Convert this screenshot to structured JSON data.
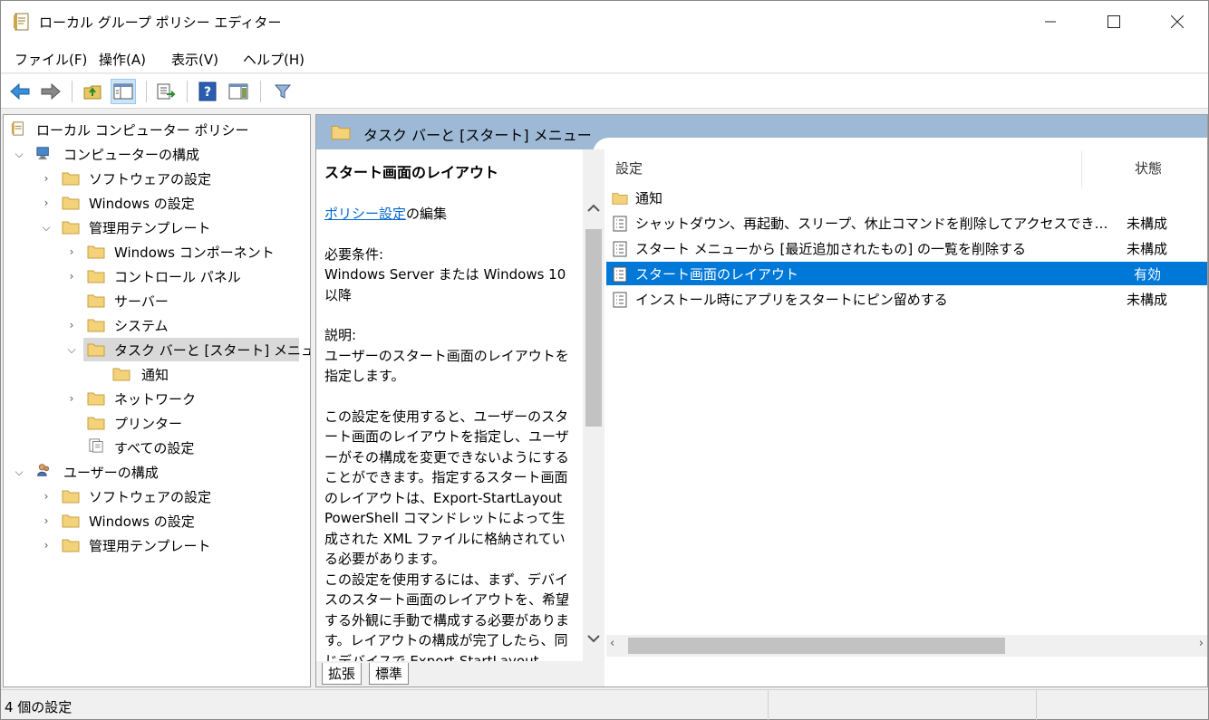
{
  "window": {
    "title": "ローカル グループ ポリシー エディター"
  },
  "menu": [
    "ファイル(F)",
    "操作(A)",
    "表示(V)",
    "ヘルプ(H)"
  ],
  "toolbar": {
    "icons": [
      "back-icon",
      "forward-icon",
      "up-folder-icon",
      "show-hide-tree-icon",
      "export-list-icon",
      "help-icon",
      "show-hide-action-pane-icon",
      "filter-icon"
    ]
  },
  "tree": {
    "root": "ローカル コンピューター ポリシー",
    "computer_config": "コンピューターの構成",
    "cc_software": "ソフトウェアの設定",
    "cc_windows": "Windows の設定",
    "cc_admin": "管理用テンプレート",
    "admin_wincomp": "Windows コンポーネント",
    "admin_control": "コントロール パネル",
    "admin_server": "サーバー",
    "admin_system": "システム",
    "admin_taskbar": "タスク バーと [スタート] メニュー",
    "taskbar_notify": "通知",
    "admin_network": "ネットワーク",
    "admin_printer": "プリンター",
    "admin_all": "すべての設定",
    "user_config": "ユーザーの構成",
    "uc_software": "ソフトウェアの設定",
    "uc_windows": "Windows の設定",
    "uc_admin": "管理用テンプレート"
  },
  "pane": {
    "header": "タスク バーと [スタート] メニュー",
    "desc_title": "スタート画面のレイアウト",
    "desc_link": "ポリシー設定",
    "desc_link_suffix": "の編集",
    "req_label": "必要条件:",
    "req_text": "Windows Server または Windows 10 以降",
    "expl_label": "説明:",
    "expl_text": "ユーザーのスタート画面のレイアウトを指定します。",
    "para1": "この設定を使用すると、ユーザーのスタート画面のレイアウトを指定し、ユーザーがその構成を変更できないようにすることができます。指定するスタート画面のレイアウトは、Export-StartLayout PowerShell コマンドレットによって生成された XML ファイルに格納されている必要があります。",
    "para2": "この設定を使用するには、まず、デバイスのスタート画面のレイアウトを、希望する外観に手動で構成する必要があります。レイアウトの構成が完了したら、同じデバイスで Export-StartLayout",
    "tab_extended": "拡張",
    "tab_standard": "標準"
  },
  "list": {
    "col_setting": "設定",
    "col_state": "状態",
    "rows": [
      {
        "name": "通知",
        "state": ""
      },
      {
        "name": "シャットダウン、再起動、スリープ、休止コマンドを削除してアクセスでき…",
        "state": "未構成"
      },
      {
        "name": "スタート メニューから [最近追加されたもの] の一覧を削除する",
        "state": "未構成"
      },
      {
        "name": "スタート画面のレイアウト",
        "state": "有効"
      },
      {
        "name": "インストール時にアプリをスタートにピン留めする",
        "state": "未構成"
      }
    ]
  },
  "status": {
    "text": "4 個の設定"
  }
}
